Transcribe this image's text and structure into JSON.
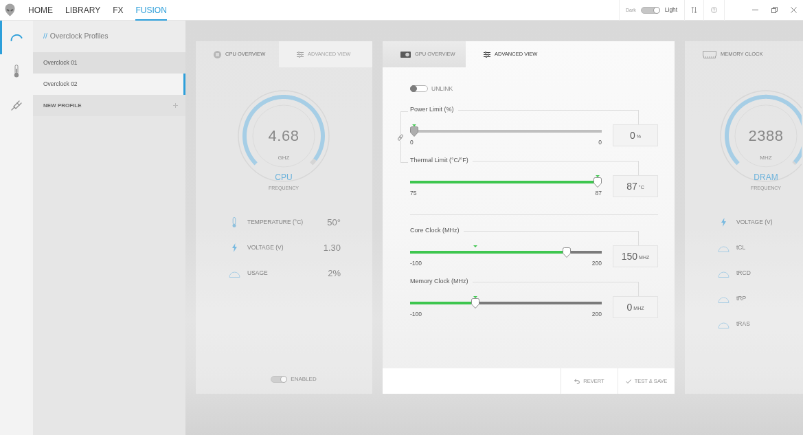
{
  "app_bar": {
    "tabs": [
      {
        "label": "HOME",
        "selected": false
      },
      {
        "label": "LIBRARY",
        "selected": false
      },
      {
        "label": "FX",
        "selected": false
      },
      {
        "label": "FUSION",
        "selected": true
      }
    ],
    "theme_switch": {
      "off_label": "Dark",
      "on_label": "Light",
      "on": true
    }
  },
  "rail": {
    "items": [
      {
        "kind": "gauge",
        "selected": true
      },
      {
        "kind": "thermometer",
        "selected": false
      },
      {
        "kind": "plug",
        "selected": false
      }
    ]
  },
  "profiles": {
    "prefix": "//",
    "title": "Overclock Profiles",
    "items": [
      {
        "kind": "profile",
        "label": "Overclock 01",
        "selected": false
      },
      {
        "kind": "profile",
        "label": "Overclock 02",
        "selected": true
      },
      {
        "kind": "action",
        "label": "NEW PROFILE",
        "selected": false
      }
    ]
  },
  "cpu_panel": {
    "dimmed": true,
    "tabs": [
      {
        "kind": "cpu",
        "label": "CPU OVERVIEW",
        "selected": true,
        "disabled": false
      },
      {
        "kind": "advanced",
        "label": "ADVANCED VIEW",
        "selected": false,
        "disabled": true
      }
    ],
    "gauge": {
      "value": "4.68",
      "unit": "GHZ",
      "name": "CPU",
      "caption": "FREQUENCY",
      "level": 0.97
    },
    "stats": [
      {
        "kind": "temperature",
        "label": "TEMPERATURE (°C)",
        "value": "50°"
      },
      {
        "kind": "voltage",
        "label": "VOLTAGE (V)",
        "value": "1.30"
      },
      {
        "kind": "usage",
        "label": "USAGE",
        "value": "2%"
      }
    ],
    "enabled_switch": {
      "label": "ENABLED",
      "on": true
    }
  },
  "gpu_panel": {
    "dimmed": false,
    "tabs": [
      {
        "kind": "gpu",
        "label": "GPU OVERVIEW",
        "selected": false,
        "disabled": false
      },
      {
        "kind": "advanced",
        "label": "ADVANCED VIEW",
        "selected": true,
        "disabled": false
      }
    ],
    "unlink_switch": {
      "label": "UNLINK",
      "on": false
    },
    "slider_groups": [
      {
        "linked": true,
        "sliders": [
          {
            "label": "Power Limit (%)",
            "disabled": true,
            "level": 0,
            "default_mark": {
              "level": 0
            },
            "min": "0",
            "max": "0",
            "value": "0",
            "unit": "%"
          },
          {
            "label": "Thermal Limit (°C/°F)",
            "disabled": false,
            "level": 1,
            "default_mark": {
              "level": 1
            },
            "min": "75",
            "max": "87",
            "value": "87",
            "unit": "°C"
          }
        ]
      },
      {
        "linked": false,
        "sliders": [
          {
            "label": "Core Clock (MHz)",
            "disabled": false,
            "level": 0.833,
            "default_mark": {
              "level": 0.333
            },
            "min": "-100",
            "max": "200",
            "value": "150",
            "unit": "MHZ"
          },
          {
            "label": "Memory Clock (MHz)",
            "disabled": false,
            "level": 0.333,
            "default_mark": {
              "level": 0.333
            },
            "min": "-100",
            "max": "200",
            "value": "0",
            "unit": "MHZ"
          }
        ]
      }
    ],
    "buttons": [
      {
        "kind": "revert",
        "label": "REVERT",
        "disabled": true
      },
      {
        "kind": "save",
        "label": "TEST & SAVE",
        "disabled": true
      }
    ]
  },
  "memory_panel": {
    "dimmed": true,
    "header": {
      "kind": "memory",
      "label": "MEMORY CLOCK"
    },
    "gauge": {
      "value": "2388",
      "unit": "MHZ",
      "name": "DRAM",
      "caption": "FREQUENCY",
      "level": 0.99
    },
    "stats": [
      {
        "kind": "voltage",
        "label": "VOLTAGE (V)"
      },
      {
        "kind": "timing",
        "label": "tCL"
      },
      {
        "kind": "timing",
        "label": "tRCD"
      },
      {
        "kind": "timing",
        "label": "tRP"
      },
      {
        "kind": "timing",
        "label": "tRAS"
      }
    ]
  }
}
